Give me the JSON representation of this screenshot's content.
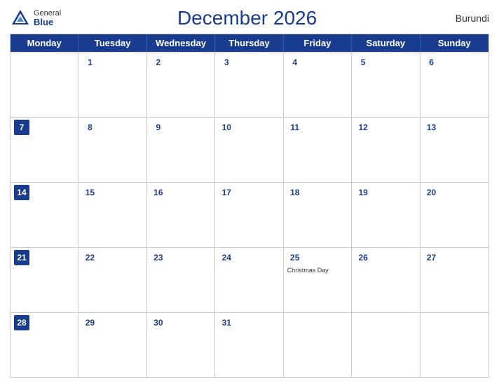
{
  "logo": {
    "general": "General",
    "blue": "Blue"
  },
  "header": {
    "title": "December 2026",
    "country": "Burundi"
  },
  "days": [
    "Monday",
    "Tuesday",
    "Wednesday",
    "Thursday",
    "Friday",
    "Saturday",
    "Sunday"
  ],
  "weeks": [
    [
      {
        "num": "",
        "holiday": ""
      },
      {
        "num": "1",
        "holiday": ""
      },
      {
        "num": "2",
        "holiday": ""
      },
      {
        "num": "3",
        "holiday": ""
      },
      {
        "num": "4",
        "holiday": ""
      },
      {
        "num": "5",
        "holiday": ""
      },
      {
        "num": "6",
        "holiday": ""
      }
    ],
    [
      {
        "num": "7",
        "holiday": ""
      },
      {
        "num": "8",
        "holiday": ""
      },
      {
        "num": "9",
        "holiday": ""
      },
      {
        "num": "10",
        "holiday": ""
      },
      {
        "num": "11",
        "holiday": ""
      },
      {
        "num": "12",
        "holiday": ""
      },
      {
        "num": "13",
        "holiday": ""
      }
    ],
    [
      {
        "num": "14",
        "holiday": ""
      },
      {
        "num": "15",
        "holiday": ""
      },
      {
        "num": "16",
        "holiday": ""
      },
      {
        "num": "17",
        "holiday": ""
      },
      {
        "num": "18",
        "holiday": ""
      },
      {
        "num": "19",
        "holiday": ""
      },
      {
        "num": "20",
        "holiday": ""
      }
    ],
    [
      {
        "num": "21",
        "holiday": ""
      },
      {
        "num": "22",
        "holiday": ""
      },
      {
        "num": "23",
        "holiday": ""
      },
      {
        "num": "24",
        "holiday": ""
      },
      {
        "num": "25",
        "holiday": "Christmas Day"
      },
      {
        "num": "26",
        "holiday": ""
      },
      {
        "num": "27",
        "holiday": ""
      }
    ],
    [
      {
        "num": "28",
        "holiday": ""
      },
      {
        "num": "29",
        "holiday": ""
      },
      {
        "num": "30",
        "holiday": ""
      },
      {
        "num": "31",
        "holiday": ""
      },
      {
        "num": "",
        "holiday": ""
      },
      {
        "num": "",
        "holiday": ""
      },
      {
        "num": "",
        "holiday": ""
      }
    ]
  ]
}
